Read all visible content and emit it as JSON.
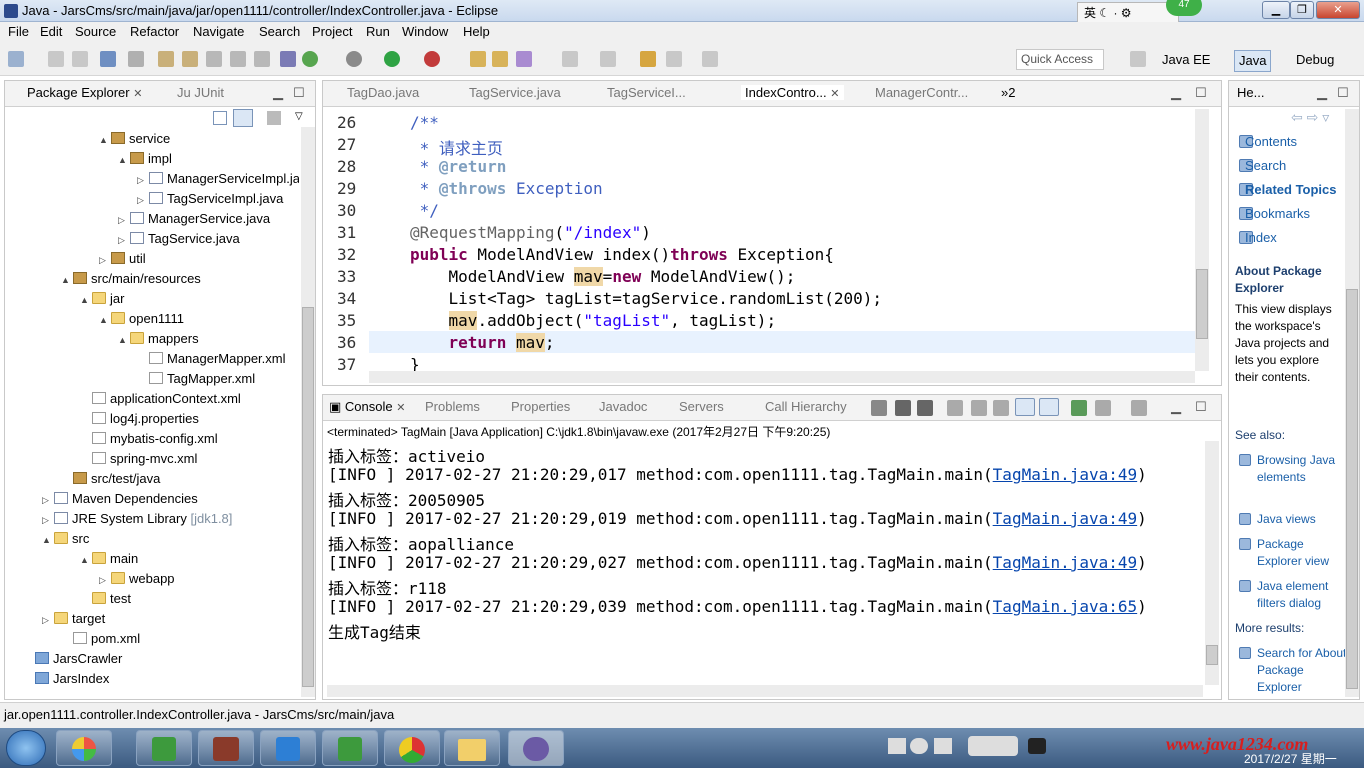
{
  "window": {
    "title": "Java - JarsCms/src/main/java/jar/open1111/controller/IndexController.java - Eclipse"
  },
  "ime": {
    "label": "英",
    "badge": "47"
  },
  "menu": [
    "File",
    "Edit",
    "Source",
    "Refactor",
    "Navigate",
    "Search",
    "Project",
    "Run",
    "Window",
    "Help"
  ],
  "toolbar": {
    "quick_access_placeholder": "Quick Access",
    "perspectives": [
      "Java EE",
      "Java",
      "Debug"
    ]
  },
  "package_explorer": {
    "tabs": [
      "Package Explorer",
      "JUnit"
    ],
    "rows": [
      {
        "label": "service",
        "indent": 4,
        "icon": "pkg",
        "twist": "▲"
      },
      {
        "label": "impl",
        "indent": 5,
        "icon": "pkg",
        "twist": "▲"
      },
      {
        "label": "ManagerServiceImpl.java",
        "indent": 6,
        "icon": "jfile",
        "twist": "▷"
      },
      {
        "label": "TagServiceImpl.java",
        "indent": 6,
        "icon": "jfile",
        "twist": "▷"
      },
      {
        "label": "ManagerService.java",
        "indent": 5,
        "icon": "jfile",
        "twist": "▷"
      },
      {
        "label": "TagService.java",
        "indent": 5,
        "icon": "jfile",
        "twist": "▷"
      },
      {
        "label": "util",
        "indent": 4,
        "icon": "pkg",
        "twist": "▷"
      },
      {
        "label": "src/main/resources",
        "indent": 2,
        "icon": "pkg",
        "twist": "▲"
      },
      {
        "label": "jar",
        "indent": 3,
        "icon": "fold",
        "twist": "▲"
      },
      {
        "label": "open1111",
        "indent": 4,
        "icon": "fold",
        "twist": "▲"
      },
      {
        "label": "mappers",
        "indent": 5,
        "icon": "fold",
        "twist": "▲"
      },
      {
        "label": "ManagerMapper.xml",
        "indent": 6,
        "icon": "xfile",
        "twist": ""
      },
      {
        "label": "TagMapper.xml",
        "indent": 6,
        "icon": "xfile",
        "twist": ""
      },
      {
        "label": "applicationContext.xml",
        "indent": 3,
        "icon": "xfile",
        "twist": ""
      },
      {
        "label": "log4j.properties",
        "indent": 3,
        "icon": "xfile",
        "twist": ""
      },
      {
        "label": "mybatis-config.xml",
        "indent": 3,
        "icon": "xfile",
        "twist": ""
      },
      {
        "label": "spring-mvc.xml",
        "indent": 3,
        "icon": "xfile",
        "twist": ""
      },
      {
        "label": "src/test/java",
        "indent": 2,
        "icon": "pkg",
        "twist": ""
      },
      {
        "label": "Maven Dependencies",
        "indent": 1,
        "icon": "jfile",
        "twist": "▷"
      },
      {
        "label": "JRE System Library",
        "extra": "[jdk1.8]",
        "indent": 1,
        "icon": "jfile",
        "twist": "▷"
      },
      {
        "label": "src",
        "indent": 1,
        "icon": "fold",
        "twist": "▲"
      },
      {
        "label": "main",
        "indent": 3,
        "icon": "fold",
        "twist": "▲"
      },
      {
        "label": "webapp",
        "indent": 4,
        "icon": "fold",
        "twist": "▷"
      },
      {
        "label": "test",
        "indent": 3,
        "icon": "fold",
        "twist": ""
      },
      {
        "label": "target",
        "indent": 1,
        "icon": "fold",
        "twist": "▷"
      },
      {
        "label": "pom.xml",
        "indent": 2,
        "icon": "xfile",
        "twist": ""
      },
      {
        "label": "JarsCrawler",
        "indent": 0,
        "icon": "proj",
        "twist": ""
      },
      {
        "label": "JarsIndex",
        "indent": 0,
        "icon": "proj",
        "twist": ""
      }
    ]
  },
  "editor": {
    "tabs": [
      "TagDao.java",
      "TagService.java",
      "TagServiceI...",
      "IndexContro...",
      "ManagerContr...",
      "»2"
    ],
    "line_numbers": [
      "26",
      "27",
      "28",
      "29",
      "30",
      "31",
      "32",
      "33",
      "34",
      "35",
      "36",
      "37"
    ]
  },
  "console": {
    "tabs": [
      "Console",
      "Problems",
      "Properties",
      "Javadoc",
      "Servers",
      "Call Hierarchy"
    ],
    "header": "<terminated> TagMain [Java Application] C:\\jdk1.8\\bin\\javaw.exe (2017年2月27日 下午9:20:25)",
    "lines": [
      {
        "text": "插入标签：activeio",
        "link": ""
      },
      {
        "text": "[INFO ] 2017-02-27 21:20:29,017 method:com.open1111.tag.TagMain.main(",
        "link": "TagMain.java:49"
      },
      {
        "text": "插入标签：20050905",
        "link": ""
      },
      {
        "text": "[INFO ] 2017-02-27 21:20:29,019 method:com.open1111.tag.TagMain.main(",
        "link": "TagMain.java:49"
      },
      {
        "text": "插入标签：aopalliance",
        "link": ""
      },
      {
        "text": "[INFO ] 2017-02-27 21:20:29,027 method:com.open1111.tag.TagMain.main(",
        "link": "TagMain.java:49"
      },
      {
        "text": "插入标签：r118",
        "link": ""
      },
      {
        "text": "[INFO ] 2017-02-27 21:20:29,039 method:com.open1111.tag.TagMain.main(",
        "link": "TagMain.java:65"
      },
      {
        "text": "生成Tag结束",
        "link": ""
      }
    ]
  },
  "help": {
    "tab": "He...",
    "links": [
      "Contents",
      "Search",
      "Related Topics",
      "Bookmarks",
      "Index"
    ],
    "about_title": "About Package Explorer",
    "about_body": "This view displays the workspace's Java projects and lets you explore their contents.",
    "see_also": "See also:",
    "see_links": [
      "Browsing Java elements",
      "Java views",
      "Package Explorer view",
      "Java element filters dialog"
    ],
    "more": "More results:",
    "more_link": "Search for About Package Explorer"
  },
  "status": {
    "text": "jar.open1111.controller.IndexController.java - JarsCms/src/main/java"
  },
  "taskbar": {
    "watermark": "www.java1234.com",
    "date": "2017/2/27 星期一"
  }
}
